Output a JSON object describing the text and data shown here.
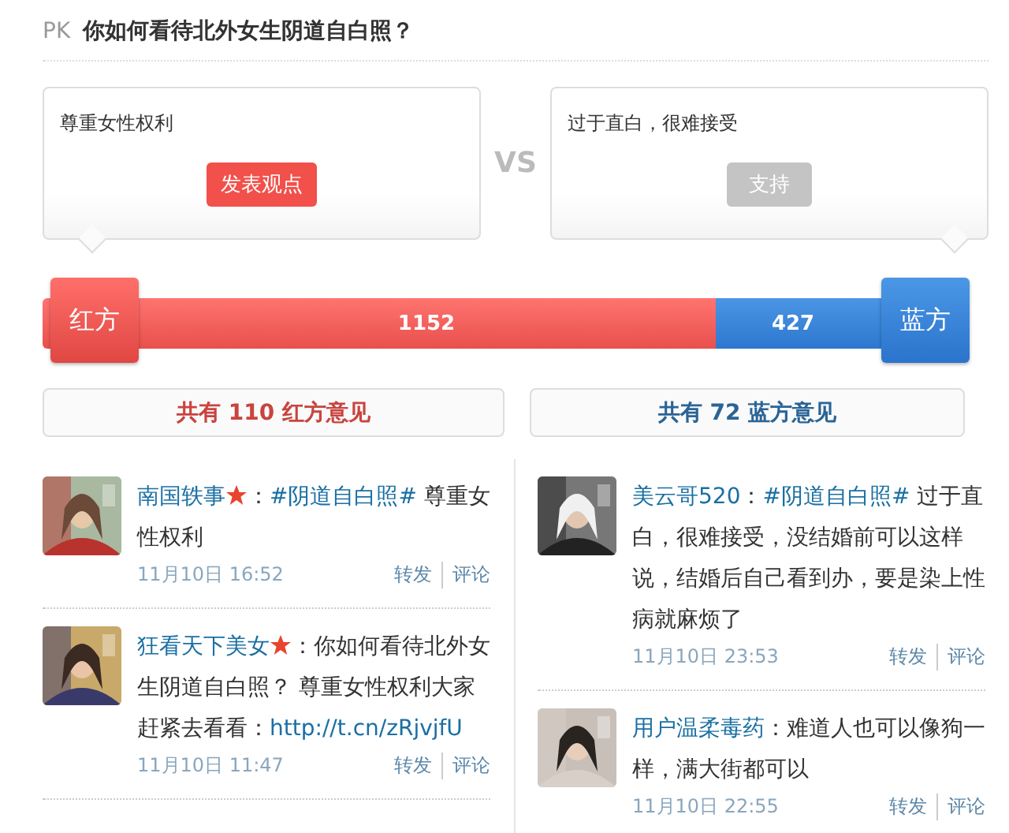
{
  "header": {
    "tag": "PK",
    "title": "你如何看待北外女生阴道自白照？"
  },
  "sides": [
    {
      "kind": "red",
      "opinion": "尊重女性权利",
      "button": {
        "label": "发表观点",
        "disabled": false
      },
      "flag": "红方",
      "votes": "1152",
      "summary": {
        "pre": "共有",
        "count": "110",
        "post": "红方意见"
      }
    },
    {
      "kind": "blue",
      "opinion": "过于直白，很难接受",
      "button": {
        "label": "支持",
        "disabled": true
      },
      "flag": "蓝方",
      "votes": "427",
      "summary": {
        "pre": "共有",
        "count": "72",
        "post": "蓝方意见"
      }
    }
  ],
  "vs": "VS",
  "bar": {
    "level": 0.73
  },
  "columns": [
    [
      {
        "author": "南国轶事",
        "starred": true,
        "sep": "：",
        "topic": "#阴道自白照#",
        "text": " 尊重女性权利",
        "time": "11月10日 16:52",
        "actions": [
          "转发",
          "评论"
        ]
      },
      {
        "author": "狂看天下美女",
        "starred": true,
        "sep": "：",
        "text": "你如何看待北外女生阴道自白照？ 尊重女性权利大家赶紧去看看：",
        "link": "http://t.cn/zRjvjfU",
        "time": "11月10日 11:47",
        "actions": [
          "转发",
          "评论"
        ]
      }
    ],
    [
      {
        "author": "美云哥520",
        "starred": false,
        "sep": "：",
        "topic": "#阴道自白照#",
        "text": " 过于直白，很难接受，没结婚前可以这样说，结婚后自己看到办，要是染上性病就麻烦了",
        "time": "11月10日 23:53",
        "actions": [
          "转发",
          "评论"
        ]
      },
      {
        "author": "用户温柔毒药",
        "starred": false,
        "sep": "：",
        "text": "难道人也可以像狗一样，满大街都可以",
        "time": "11月10日 22:55",
        "actions": [
          "转发",
          "评论"
        ]
      }
    ]
  ]
}
